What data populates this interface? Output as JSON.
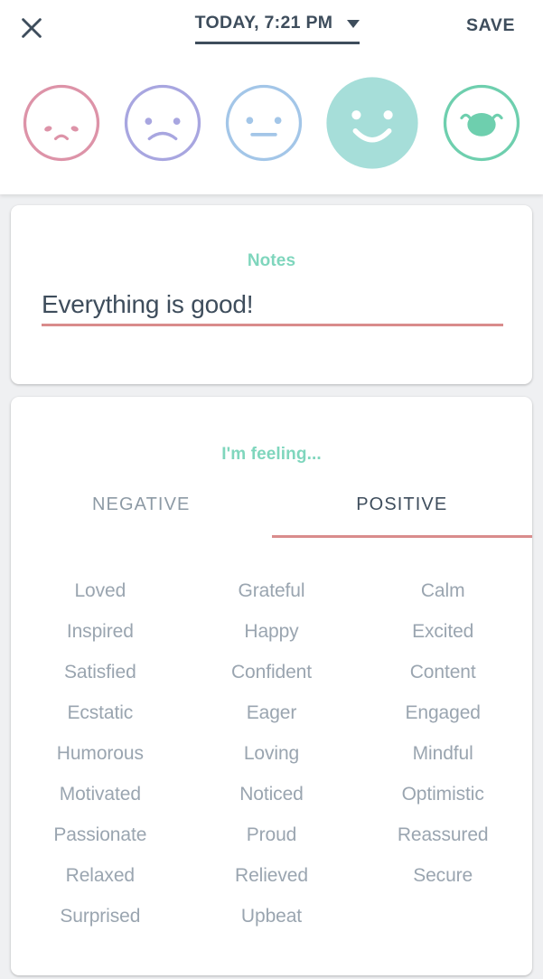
{
  "header": {
    "close_icon": "close-icon",
    "date_label": "TODAY, 7:21 PM",
    "date_caret_icon": "chevron-down-icon",
    "save_label": "SAVE",
    "accent_underline_color": "#3e4d5c"
  },
  "moods": {
    "selected_index": 3,
    "items": [
      {
        "name": "awful",
        "icon": "sad-face-icon",
        "color": "#dd93a8",
        "style": "outline",
        "mouth": "frown-small",
        "eyes": "oval"
      },
      {
        "name": "bad",
        "icon": "frowning-face-icon",
        "color": "#a8a6e0",
        "style": "outline",
        "mouth": "frown",
        "eyes": "dot"
      },
      {
        "name": "neutral",
        "icon": "neutral-face-icon",
        "color": "#a3c6e8",
        "style": "outline",
        "mouth": "line",
        "eyes": "dot"
      },
      {
        "name": "good",
        "icon": "happy-face-icon",
        "color": "#a6ded9",
        "style": "filled",
        "mouth": "smile",
        "eyes": "dot"
      },
      {
        "name": "great",
        "icon": "grinning-face-icon",
        "color": "#6ecfae",
        "style": "outline",
        "mouth": "open-smile",
        "eyes": "arch"
      }
    ]
  },
  "notes_card": {
    "title": "Notes",
    "title_color": "#7fd6bd",
    "value": "Everything is good!",
    "placeholder": "Notes",
    "underline_color": "#d98c8c"
  },
  "feelings_card": {
    "title": "I'm feeling...",
    "title_color": "#7fd6bd",
    "tabs": [
      {
        "label": "NEGATIVE",
        "active": false
      },
      {
        "label": "POSITIVE",
        "active": true
      }
    ],
    "active_tab_underline_color": "#d98c8c",
    "words": [
      "Loved",
      "Grateful",
      "Calm",
      "Inspired",
      "Happy",
      "Excited",
      "Satisfied",
      "Confident",
      "Content",
      "Ecstatic",
      "Eager",
      "Engaged",
      "Humorous",
      "Loving",
      "Mindful",
      "Motivated",
      "Noticed",
      "Optimistic",
      "Passionate",
      "Proud",
      "Reassured",
      "Relaxed",
      "Relieved",
      "Secure",
      "Surprised",
      "Upbeat",
      ""
    ]
  }
}
